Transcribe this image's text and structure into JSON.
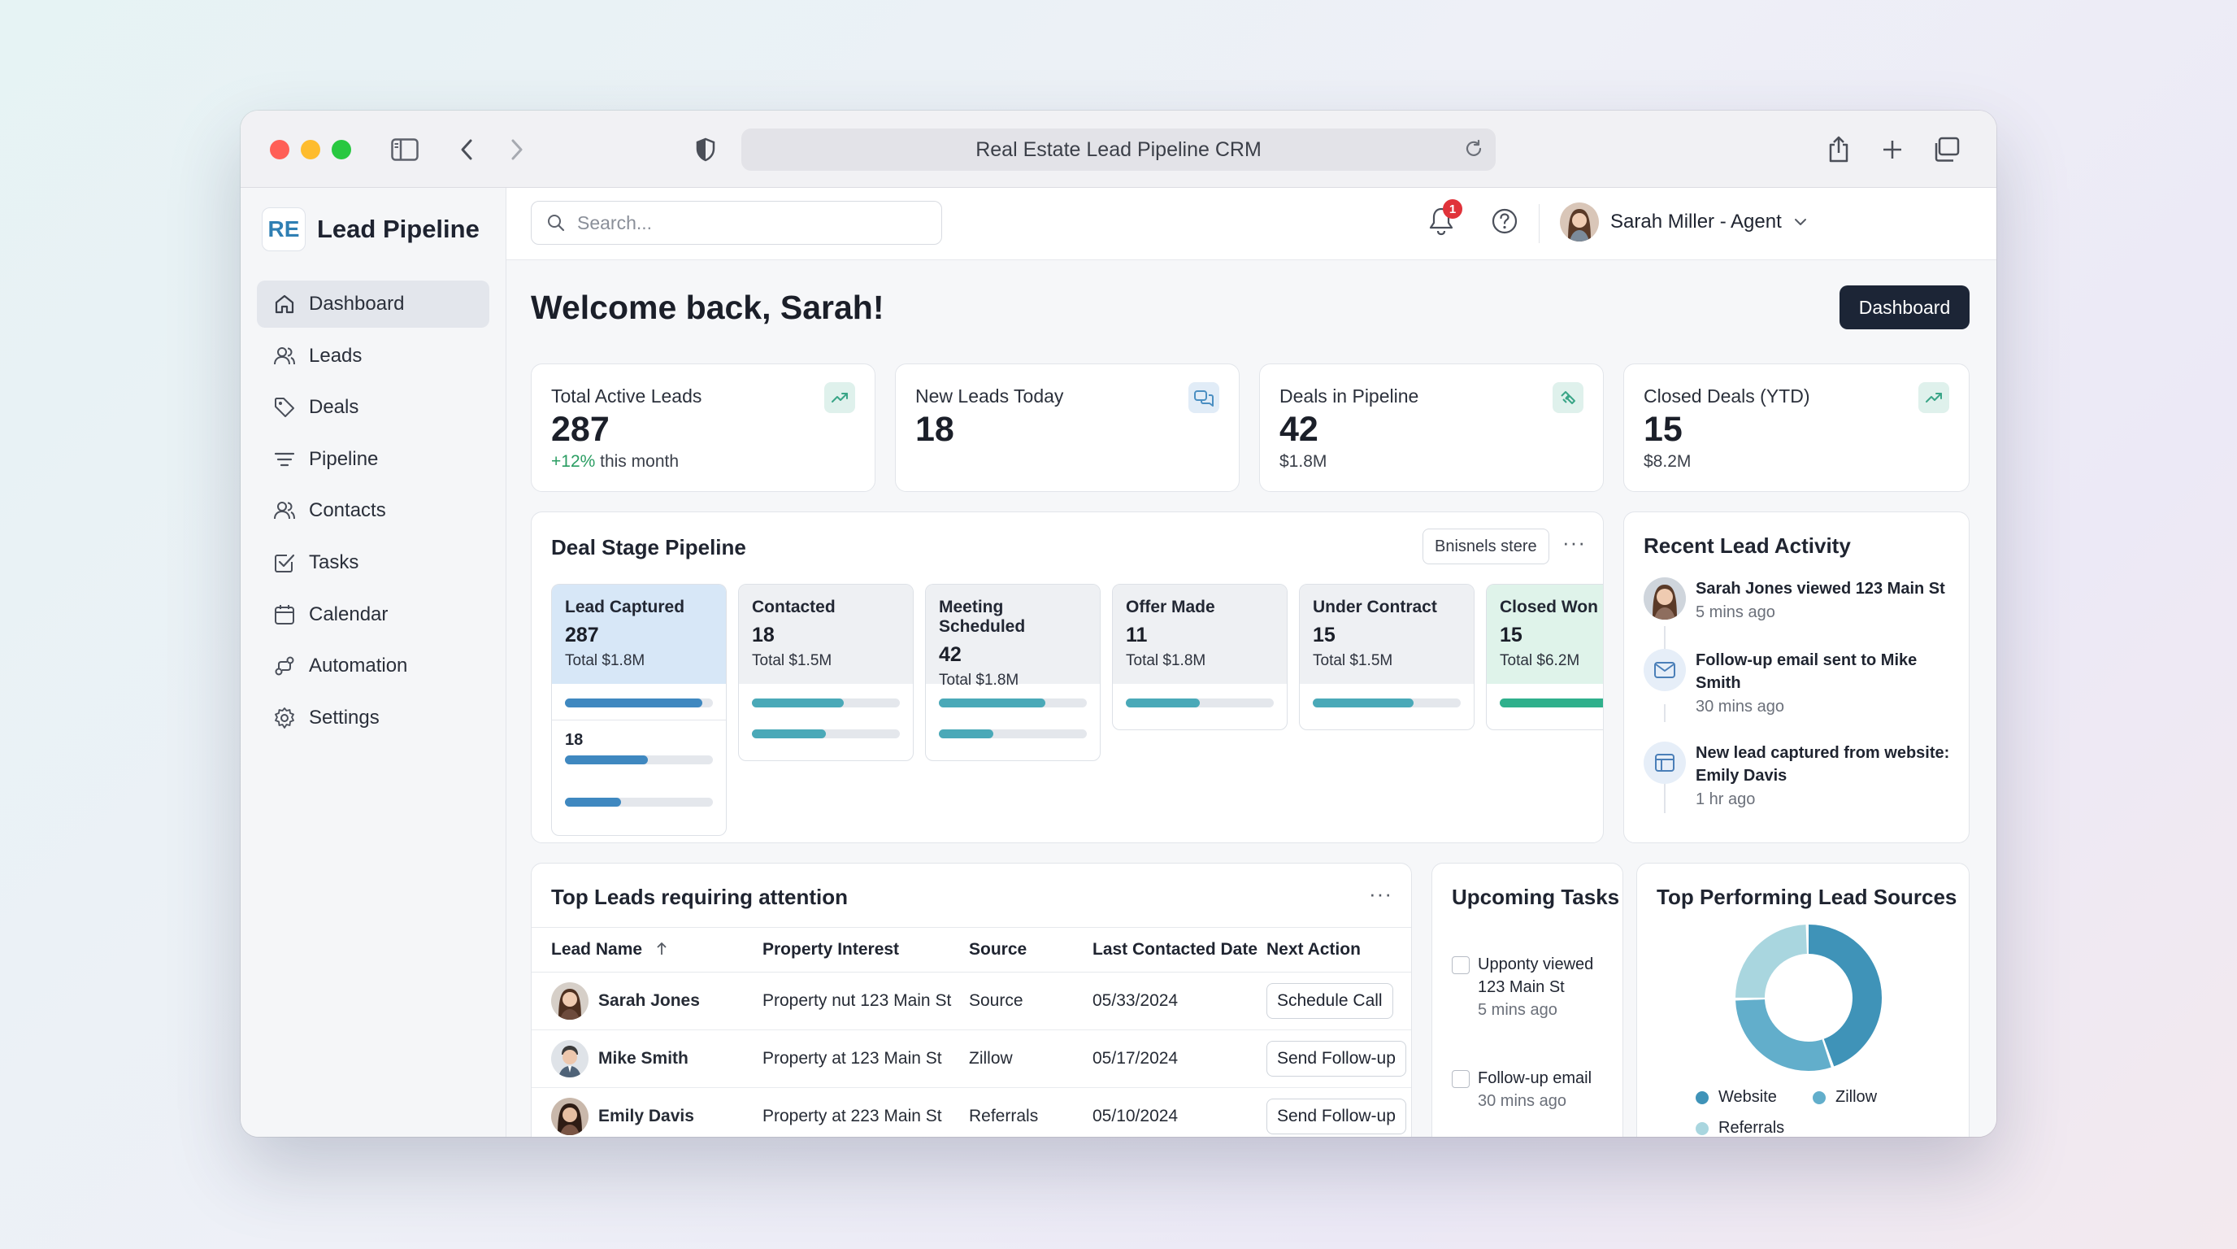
{
  "browser": {
    "title": "Real Estate Lead Pipeline CRM"
  },
  "sidebar": {
    "logo": "RE",
    "brand": "Lead Pipeline",
    "items": [
      {
        "label": "Dashboard",
        "icon": "home-icon"
      },
      {
        "label": "Leads",
        "icon": "users-icon"
      },
      {
        "label": "Deals",
        "icon": "tag-icon"
      },
      {
        "label": "Pipeline",
        "icon": "filter-icon"
      },
      {
        "label": "Contacts",
        "icon": "contacts-icon"
      },
      {
        "label": "Tasks",
        "icon": "checkbox-icon"
      },
      {
        "label": "Calendar",
        "icon": "calendar-icon"
      },
      {
        "label": "Automation",
        "icon": "automation-icon"
      },
      {
        "label": "Settings",
        "icon": "gear-icon"
      }
    ]
  },
  "header": {
    "search_placeholder": "Search...",
    "notification_count": "1",
    "user_name": "Sarah Miller - Agent"
  },
  "page": {
    "welcome": "Welcome back, Sarah!",
    "dashboard_button": "Dashboard"
  },
  "stats": [
    {
      "label": "Total Active Leads",
      "value": "287",
      "sub_change": "+12%",
      "sub": " this month",
      "icon": "trending-up-icon"
    },
    {
      "label": "New Leads Today",
      "value": "18",
      "sub_change": "",
      "sub": "",
      "icon": "chat-icon"
    },
    {
      "label": "Deals in Pipeline",
      "value": "42",
      "sub_change": "",
      "sub": "$1.8M",
      "icon": "handshake-icon"
    },
    {
      "label": "Closed Deals (YTD)",
      "value": "15",
      "sub_change": "",
      "sub": "$8.2M",
      "icon": "trending-up-icon"
    }
  ],
  "pipeline": {
    "title": "Deal Stage Pipeline",
    "filter_chip": "Bnisnels stere",
    "stages": [
      {
        "name": "Lead Captured",
        "count": "287",
        "total": "Total $1.8M",
        "progress": [
          0.93
        ],
        "extra_label": "18",
        "extra_progress": [
          0.56,
          0.38
        ]
      },
      {
        "name": "Contacted",
        "count": "18",
        "total": "Total $1.5M",
        "progress": [
          0.62,
          0.5
        ]
      },
      {
        "name": "Meeting Scheduled",
        "count": "42",
        "total": "Total $1.8M",
        "progress": [
          0.72,
          0.37
        ]
      },
      {
        "name": "Offer Made",
        "count": "11",
        "total": "Total $1.8M",
        "progress": [
          0.5
        ]
      },
      {
        "name": "Under Contract",
        "count": "15",
        "total": "Total $1.5M",
        "progress": [
          0.68
        ]
      },
      {
        "name": "Closed Won",
        "count": "15",
        "total": "Total $6.2M",
        "progress": [
          0.85
        ]
      }
    ]
  },
  "activity": {
    "title": "Recent Lead Activity",
    "items": [
      {
        "text": "Sarah Jones viewed 123 Main St",
        "time": "5 mins ago",
        "icon": "avatar"
      },
      {
        "text": "Follow-up email sent to Mike Smith",
        "time": "30 mins ago",
        "icon": "mail-icon"
      },
      {
        "text": "New lead captured from website: Emily Davis",
        "time": "1 hr ago",
        "icon": "browser-icon"
      }
    ]
  },
  "leads_table": {
    "title": "Top Leads requiring attention",
    "columns": [
      "Lead Name",
      "Property Interest",
      "Source",
      "Last Contacted Date",
      "Next Action"
    ],
    "rows": [
      {
        "name": "Sarah Jones",
        "property": "Property nut 123 Main St",
        "source": "Source",
        "date": "05/33/2024",
        "action": "Schedule Call"
      },
      {
        "name": "Mike Smith",
        "property": "Property at 123 Main St",
        "source": "Zillow",
        "date": "05/17/2024",
        "action": "Send Follow-up"
      },
      {
        "name": "Emily Davis",
        "property": "Property at 223 Main St",
        "source": "Referrals",
        "date": "05/10/2024",
        "action": "Send Follow-up"
      }
    ]
  },
  "tasks": {
    "title": "Upcoming Tasks",
    "items": [
      {
        "text": "Upponty viewed 123 Main St",
        "time": "5 mins ago"
      },
      {
        "text": "Follow-up email",
        "time": "30 mins ago"
      }
    ]
  },
  "sources": {
    "title": "Top Performing Lead Sources",
    "segments": [
      {
        "name": "Website",
        "value": 0.45,
        "color": "#3f93b8"
      },
      {
        "name": "Zillow",
        "value": 0.3,
        "color": "#62aecb"
      },
      {
        "name": "Referrals",
        "value": 0.25,
        "color": "#a9d6df"
      }
    ]
  }
}
